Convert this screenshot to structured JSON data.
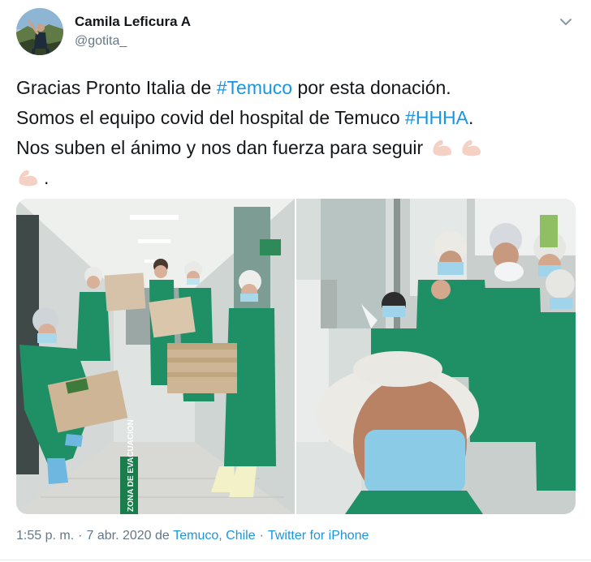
{
  "tweet": {
    "author": {
      "display_name": "Camila Leficura A",
      "handle": "@gotita_"
    },
    "text": {
      "line1_pre": "Gracias Pronto Italia de ",
      "line1_tag": "#Temuco",
      "line1_post": " por esta donación.",
      "line2_pre": "Somos el equipo covid del hospital de Temuco ",
      "line2_tag": "#HHHA",
      "line2_post": ".",
      "line3": "Nos suben el ánimo y nos dan fuerza para seguir",
      "line4_post": "."
    },
    "media": {
      "left_sign_text": "ZONA DE EVACUACION"
    },
    "footer": {
      "time": "1:55 p. m.",
      "separator": "·",
      "date_prefix": "7 abr. 2020 de",
      "location": "Temuco, Chile",
      "source": "Twitter for iPhone"
    }
  },
  "colors": {
    "link": "#1b95e0",
    "text": "#14171a",
    "muted": "#657786",
    "scrubs": "#1f8f66"
  },
  "icons": [
    "avatar",
    "chevron-down-icon",
    "flexed-biceps-emoji"
  ]
}
